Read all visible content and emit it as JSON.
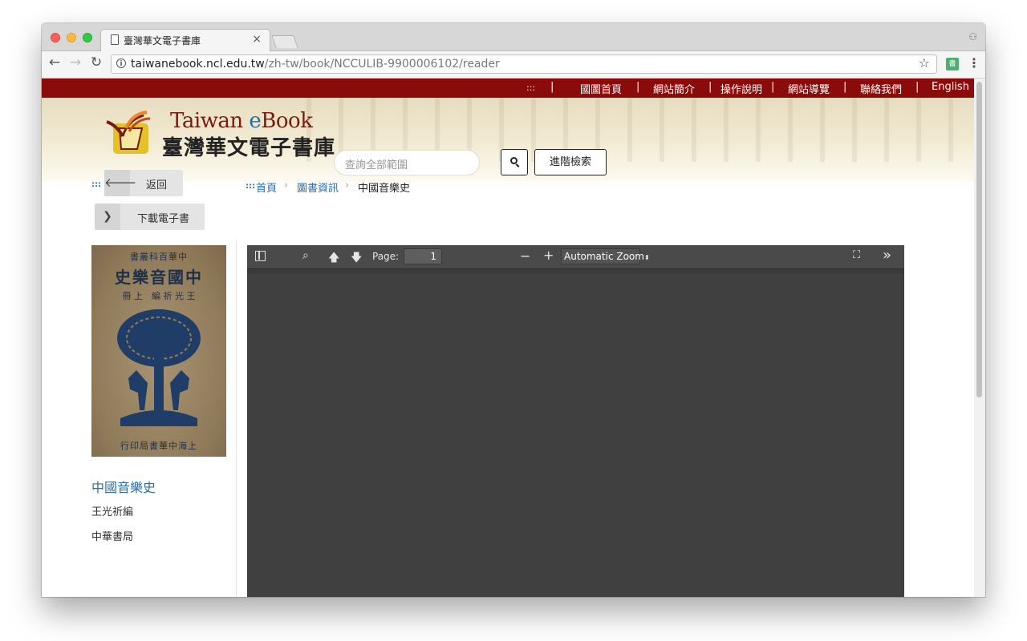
{
  "browser": {
    "tab_title": "臺灣華文電子書庫",
    "tab_close": "×",
    "url_host": "taiwanebook.ncl.edu.tw",
    "url_path": "/zh-tw/book/NCCULIB-9900006102/reader",
    "ext_label": "書",
    "colors": {
      "close": "#fc605c",
      "minimize": "#fdbc40",
      "zoom": "#34c84a"
    }
  },
  "topnav": {
    "colons": ":::",
    "items": [
      "國圖首頁",
      "網站簡介",
      "操作說明",
      "網站導覽",
      "聯絡我們",
      "English"
    ],
    "separator": "|",
    "bg_color": "#8b0b0b"
  },
  "header": {
    "logo_en_1": "Taiwan ",
    "logo_en_2": "e",
    "logo_en_3": "Book",
    "logo_zh": "臺灣華文電子書庫",
    "search_placeholder": "查詢全部範圍",
    "advanced_search": "進階檢索"
  },
  "actions": {
    "colons": ":::",
    "back_label": "返回",
    "download_label": "下載電子書"
  },
  "breadcrumb": {
    "colons": ":::",
    "home": "首頁",
    "info": "圖書資訊",
    "current": "中國音樂史",
    "arrow": "›"
  },
  "book": {
    "title": "中國音樂史",
    "author": "王光祈編",
    "publisher": "中華書局",
    "cover": {
      "series": "書叢科百華中",
      "title": "史樂音國中",
      "volume": "冊 上",
      "editor": "編 祈 光 王",
      "imprint": "行印局書華中海上"
    }
  },
  "viewer": {
    "page_label": "Page:",
    "page_value": "1",
    "zoom_value": "Automatic Zoom",
    "zoom_out": "−",
    "zoom_in": "+",
    "more": "»"
  }
}
